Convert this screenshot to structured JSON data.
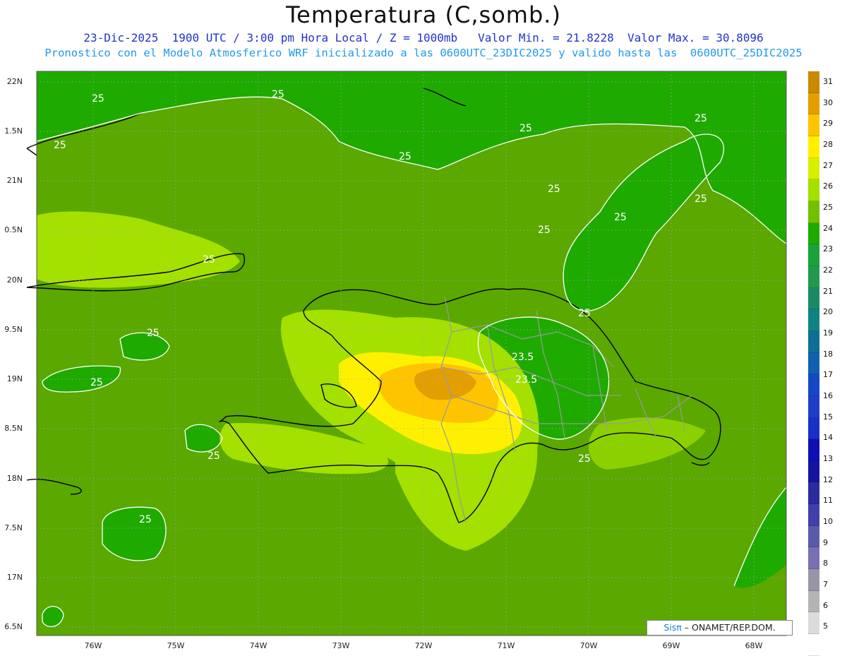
{
  "title": "Temperatura (C,somb.)",
  "subtitle1": "23-Dic-2025  1900 UTC / 3:00 pm Hora Local / Z = 1000mb   Valor Min. = 21.8228  Valor Max. = 30.8096",
  "subtitle2": "Pronostico con el Modelo Atmosferico WRF inicializado a las 0600UTC_23DIC2025 y valido hasta las  0600UTC_25DIC2025",
  "credit": {
    "brand": "Sisπ",
    "text": " – ONAMET/REP.DOM."
  },
  "lat_ticks": [
    "22N",
    "1.5N",
    "21N",
    "0.5N",
    "20N",
    "9.5N",
    "19N",
    "8.5N",
    "18N",
    "7.5N",
    "17N",
    "6.5N"
  ],
  "lon_ticks": [
    "76W",
    "75W",
    "74W",
    "73W",
    "72W",
    "71W",
    "70W",
    "69W",
    "68W"
  ],
  "colorbar": {
    "labels": [
      "31",
      "30",
      "29",
      "28",
      "27",
      "26",
      "25",
      "24",
      "23",
      "22",
      "21",
      "20",
      "19",
      "18",
      "17",
      "16",
      "15",
      "14",
      "13",
      "12",
      "11",
      "10",
      "9",
      "8",
      "7",
      "6",
      "5"
    ],
    "colors": [
      "#c88a00",
      "#e39e00",
      "#ffc400",
      "#fff000",
      "#d6f000",
      "#a4e000",
      "#72c000",
      "#1faa00",
      "#1ba23a",
      "#20994e",
      "#1a8a64",
      "#118282",
      "#0e6e96",
      "#1160b0",
      "#1548c4",
      "#1e3ec8",
      "#1830c8",
      "#0f0fb4",
      "#1414a0",
      "#2b2ba0",
      "#4040aa",
      "#5a5aaa",
      "#7870b0",
      "#9696a8",
      "#b4b4b4",
      "#dcdcdc",
      "#ffffff"
    ]
  },
  "contour_labels": [
    "25",
    "25",
    "25",
    "25",
    "25",
    "25",
    "25",
    "25",
    "25",
    "25",
    "25",
    "25",
    "25",
    "25",
    "25",
    "25",
    "25",
    "23.5",
    "23.5"
  ],
  "colors": {
    "sea": "#55a800",
    "warm": "#a4e000",
    "cool": "#1faa00",
    "hot": "#e39e00"
  }
}
